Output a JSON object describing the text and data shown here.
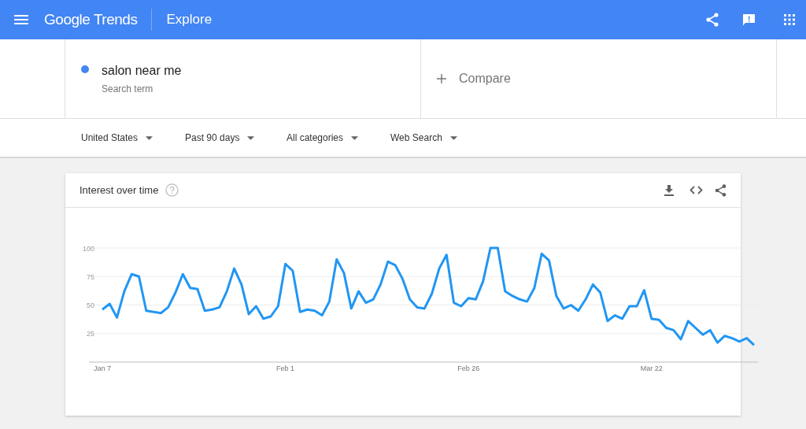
{
  "app_bar": {
    "brand": "Google Trends",
    "page_title": "Explore"
  },
  "search_terms": [
    {
      "term": "salon near me",
      "subtitle": "Search term",
      "color": "#4285f4"
    }
  ],
  "compare": {
    "label": "Compare"
  },
  "filters": [
    "United States",
    "Past 90 days",
    "All categories",
    "Web Search"
  ],
  "interest_card": {
    "title": "Interest over time",
    "chart_data": {
      "type": "line",
      "grid": true,
      "ylim": [
        0,
        100
      ],
      "yticks": [
        25,
        50,
        75,
        100
      ],
      "categories": [
        "Jan 7",
        null,
        null,
        null,
        null,
        null,
        null,
        null,
        null,
        null,
        null,
        null,
        null,
        null,
        null,
        null,
        null,
        null,
        null,
        null,
        null,
        null,
        null,
        null,
        null,
        "Feb 1",
        null,
        null,
        null,
        null,
        null,
        null,
        null,
        null,
        null,
        null,
        null,
        null,
        null,
        null,
        null,
        null,
        null,
        null,
        null,
        null,
        null,
        null,
        null,
        null,
        "Feb 26",
        null,
        null,
        null,
        null,
        null,
        null,
        null,
        null,
        null,
        null,
        null,
        null,
        null,
        null,
        null,
        null,
        null,
        null,
        null,
        null,
        null,
        null,
        null,
        null,
        "Mar 22",
        null,
        null,
        null,
        null,
        null,
        null,
        null,
        null,
        null,
        null,
        null,
        null,
        null,
        null
      ],
      "series": [
        {
          "color": "#2196f3",
          "values": [
            46,
            51,
            39,
            62,
            77,
            75,
            45,
            44,
            43,
            48,
            61,
            77,
            65,
            64,
            45,
            46,
            48,
            62,
            82,
            68,
            42,
            49,
            38,
            40,
            49,
            86,
            80,
            44,
            46,
            45,
            41,
            53,
            90,
            78,
            47,
            62,
            52,
            55,
            68,
            88,
            85,
            73,
            55,
            48,
            47,
            60,
            82,
            94,
            52,
            49,
            56,
            55,
            71,
            100,
            100,
            62,
            58,
            55,
            53,
            65,
            95,
            89,
            58,
            47,
            50,
            45,
            55,
            68,
            61,
            36,
            41,
            38,
            49,
            49,
            63,
            38,
            37,
            30,
            28,
            20,
            36,
            30,
            24,
            28,
            17,
            23,
            21,
            18,
            21,
            15
          ]
        }
      ]
    }
  }
}
